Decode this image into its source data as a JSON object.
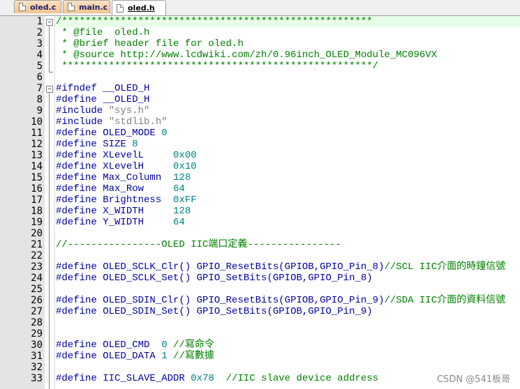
{
  "tabs": [
    {
      "label": "oled.c",
      "active": false
    },
    {
      "label": "main.c",
      "active": false
    },
    {
      "label": "oled.h",
      "active": true
    }
  ],
  "editor": {
    "lines": [
      {
        "n": "1",
        "parts": [
          {
            "t": "/*****************************************************",
            "c": "cmt"
          }
        ]
      },
      {
        "n": "2",
        "parts": [
          {
            "t": " * @file  oled.h",
            "c": "cmt"
          }
        ]
      },
      {
        "n": "3",
        "parts": [
          {
            "t": " * @brief header file for oled.h",
            "c": "cmt"
          }
        ]
      },
      {
        "n": "4",
        "parts": [
          {
            "t": " * @source http://www.lcdwiki.com/zh/0.96inch_OLED_Module_MC096VX",
            "c": "cmt"
          }
        ]
      },
      {
        "n": "5",
        "parts": [
          {
            "t": " *****************************************************/",
            "c": "cmt"
          }
        ]
      },
      {
        "n": "6",
        "parts": []
      },
      {
        "n": "7",
        "parts": [
          {
            "t": "#ifndef ",
            "c": "pp"
          },
          {
            "t": "__OLED_H",
            "c": "id"
          }
        ]
      },
      {
        "n": "8",
        "parts": [
          {
            "t": "#define ",
            "c": "pp"
          },
          {
            "t": "__OLED_H",
            "c": "id"
          }
        ]
      },
      {
        "n": "9",
        "parts": [
          {
            "t": "#include ",
            "c": "pp"
          },
          {
            "t": "\"sys.h\"",
            "c": "str"
          }
        ]
      },
      {
        "n": "10",
        "parts": [
          {
            "t": "#include ",
            "c": "pp"
          },
          {
            "t": "\"stdlib.h\"",
            "c": "str"
          }
        ]
      },
      {
        "n": "11",
        "parts": [
          {
            "t": "#define ",
            "c": "pp"
          },
          {
            "t": "OLED_MODE ",
            "c": "id"
          },
          {
            "t": "0",
            "c": "num"
          }
        ]
      },
      {
        "n": "12",
        "parts": [
          {
            "t": "#define ",
            "c": "pp"
          },
          {
            "t": "SIZE ",
            "c": "id"
          },
          {
            "t": "8",
            "c": "num"
          }
        ]
      },
      {
        "n": "13",
        "parts": [
          {
            "t": "#define ",
            "c": "pp"
          },
          {
            "t": "XLevelL     ",
            "c": "id"
          },
          {
            "t": "0x00",
            "c": "num"
          }
        ]
      },
      {
        "n": "14",
        "parts": [
          {
            "t": "#define ",
            "c": "pp"
          },
          {
            "t": "XLevelH     ",
            "c": "id"
          },
          {
            "t": "0x10",
            "c": "num"
          }
        ]
      },
      {
        "n": "15",
        "parts": [
          {
            "t": "#define ",
            "c": "pp"
          },
          {
            "t": "Max_Column  ",
            "c": "id"
          },
          {
            "t": "128",
            "c": "num"
          }
        ]
      },
      {
        "n": "16",
        "parts": [
          {
            "t": "#define ",
            "c": "pp"
          },
          {
            "t": "Max_Row     ",
            "c": "id"
          },
          {
            "t": "64",
            "c": "num"
          }
        ]
      },
      {
        "n": "17",
        "parts": [
          {
            "t": "#define ",
            "c": "pp"
          },
          {
            "t": "Brightness  ",
            "c": "id"
          },
          {
            "t": "0xFF",
            "c": "num"
          }
        ]
      },
      {
        "n": "18",
        "parts": [
          {
            "t": "#define ",
            "c": "pp"
          },
          {
            "t": "X_WIDTH     ",
            "c": "id"
          },
          {
            "t": "128",
            "c": "num"
          }
        ]
      },
      {
        "n": "19",
        "parts": [
          {
            "t": "#define ",
            "c": "pp"
          },
          {
            "t": "Y_WIDTH     ",
            "c": "id"
          },
          {
            "t": "64",
            "c": "num"
          }
        ]
      },
      {
        "n": "20",
        "parts": []
      },
      {
        "n": "21",
        "parts": [
          {
            "t": "//----------------OLED IIC端口定義----------------",
            "c": "cmt"
          }
        ]
      },
      {
        "n": "22",
        "parts": []
      },
      {
        "n": "23",
        "parts": [
          {
            "t": "#define ",
            "c": "pp"
          },
          {
            "t": "OLED_SCLK_Clr() GPIO_ResetBits(GPIOB,GPIO_Pin_8)",
            "c": "id"
          },
          {
            "t": "//SCL IIC介面的時鐘信號",
            "c": "cmt"
          }
        ]
      },
      {
        "n": "24",
        "parts": [
          {
            "t": "#define ",
            "c": "pp"
          },
          {
            "t": "OLED_SCLK_Set() GPIO_SetBits(GPIOB,GPIO_Pin_8)",
            "c": "id"
          }
        ]
      },
      {
        "n": "25",
        "parts": []
      },
      {
        "n": "26",
        "parts": [
          {
            "t": "#define ",
            "c": "pp"
          },
          {
            "t": "OLED_SDIN_Clr() GPIO_ResetBits(GPIOB,GPIO_Pin_9)",
            "c": "id"
          },
          {
            "t": "//SDA IIC介面的資料信號",
            "c": "cmt"
          }
        ]
      },
      {
        "n": "27",
        "parts": [
          {
            "t": "#define ",
            "c": "pp"
          },
          {
            "t": "OLED_SDIN_Set() GPIO_SetBits(GPIOB,GPIO_Pin_9)",
            "c": "id"
          }
        ]
      },
      {
        "n": "28",
        "parts": []
      },
      {
        "n": "29",
        "parts": []
      },
      {
        "n": "30",
        "parts": [
          {
            "t": "#define ",
            "c": "pp"
          },
          {
            "t": "OLED_CMD  ",
            "c": "id"
          },
          {
            "t": "0",
            "c": "num"
          },
          {
            "t": " //寫命令",
            "c": "cmt"
          }
        ]
      },
      {
        "n": "31",
        "parts": [
          {
            "t": "#define ",
            "c": "pp"
          },
          {
            "t": "OLED_DATA ",
            "c": "id"
          },
          {
            "t": "1",
            "c": "num"
          },
          {
            "t": " //寫數據",
            "c": "cmt"
          }
        ]
      },
      {
        "n": "32",
        "parts": []
      },
      {
        "n": "33",
        "parts": [
          {
            "t": "#define ",
            "c": "pp"
          },
          {
            "t": "IIC_SLAVE_ADDR ",
            "c": "id"
          },
          {
            "t": "0x78",
            "c": "num"
          },
          {
            "t": "  //IIC slave device address",
            "c": "cmt"
          }
        ]
      }
    ]
  },
  "watermark": "CSDN @541板哥",
  "colors": {
    "comment": "#008000",
    "preprocessor": "#0000a0",
    "string": "#808080",
    "number": "#008080",
    "gutter": "#e4e4e4",
    "current_line": "#e8ffe8",
    "tab_inactive": "#f3c48f"
  }
}
